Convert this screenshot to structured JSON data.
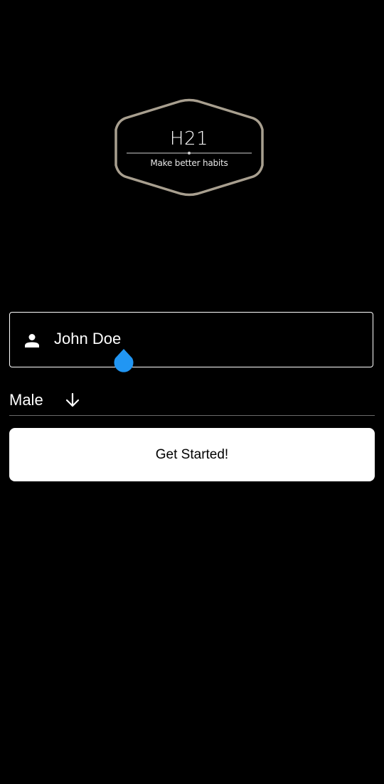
{
  "logo": {
    "title": "H21",
    "subtitle": "Make better habits",
    "border_color": "#a89f8f"
  },
  "name_field": {
    "icon": "person-icon",
    "value": "John Doe"
  },
  "gender_select": {
    "selected": "Male",
    "icon": "arrow-down-icon"
  },
  "start_button": {
    "label": "Get Started!"
  },
  "colors": {
    "background": "#000000",
    "accent": "#2196f3",
    "button_bg": "#ffffff",
    "button_text": "#000000"
  }
}
